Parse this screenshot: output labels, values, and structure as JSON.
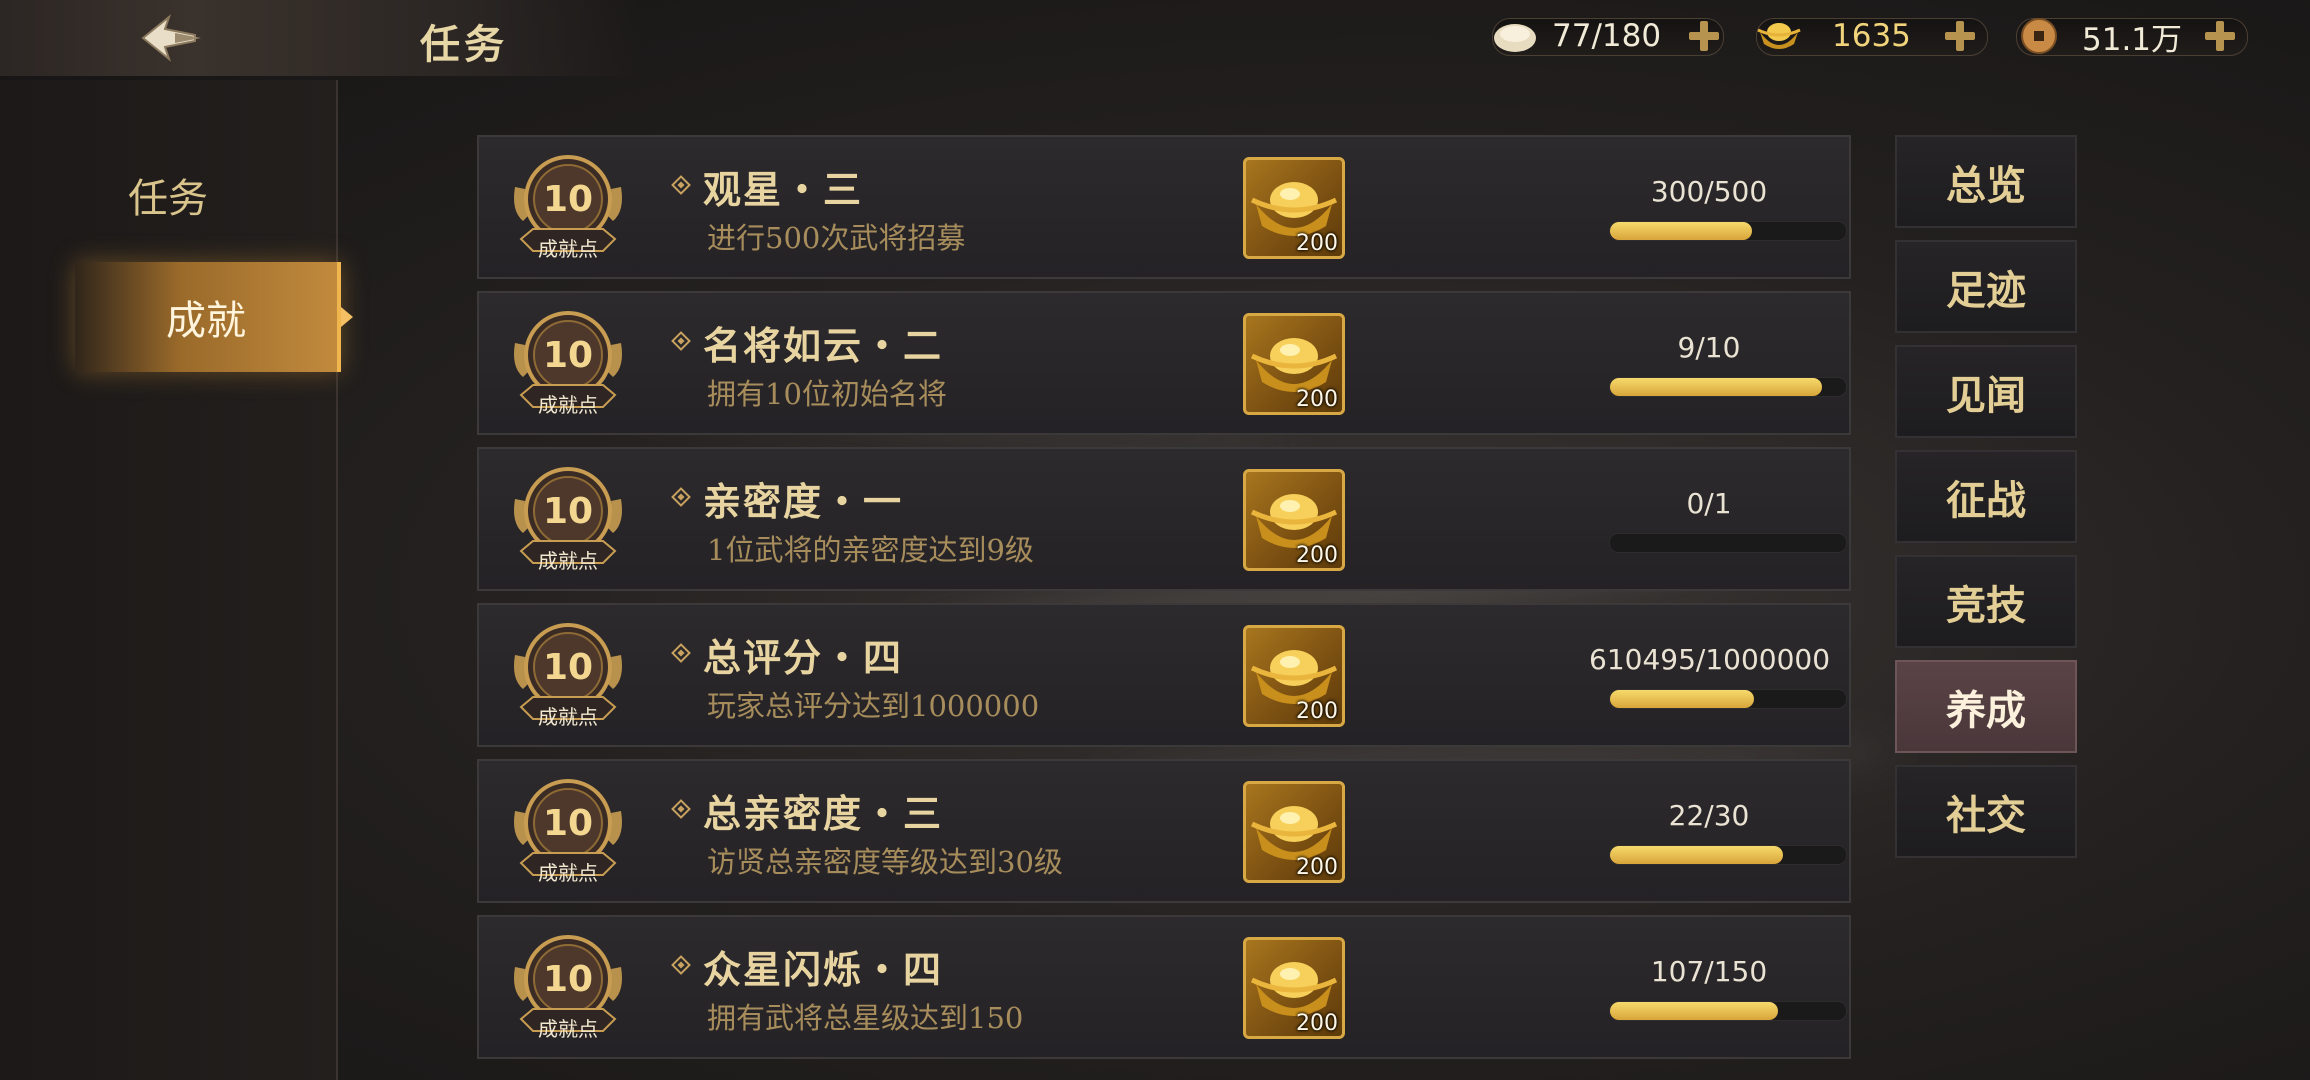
{
  "header": {
    "title": "任务",
    "resources": [
      {
        "icon": "bun-stamina-icon",
        "value": "77/180"
      },
      {
        "icon": "gold-ingot-icon",
        "value": "1635"
      },
      {
        "icon": "copper-coin-icon",
        "value": "51.1万"
      }
    ]
  },
  "sidebar": {
    "items": [
      {
        "label": "任务",
        "active": false
      },
      {
        "label": "成就",
        "active": true
      }
    ]
  },
  "tasks": [
    {
      "points": "10",
      "points_label": "成就点",
      "name": "观星・三",
      "desc": "进行500次武将招募",
      "reward_icon": "gold-ingot-icon",
      "reward_count": "200",
      "progress_text": "300/500",
      "progress": 0.6
    },
    {
      "points": "10",
      "points_label": "成就点",
      "name": "名将如云・二",
      "desc": "拥有10位初始名将",
      "reward_icon": "gold-ingot-icon",
      "reward_count": "200",
      "progress_text": "9/10",
      "progress": 0.9
    },
    {
      "points": "10",
      "points_label": "成就点",
      "name": "亲密度・一",
      "desc": "1位武将的亲密度达到9级",
      "reward_icon": "gold-ingot-icon",
      "reward_count": "200",
      "progress_text": "0/1",
      "progress": 0.0
    },
    {
      "points": "10",
      "points_label": "成就点",
      "name": "总评分・四",
      "desc": "玩家总评分达到1000000",
      "reward_icon": "gold-ingot-icon",
      "reward_count": "200",
      "progress_text": "610495/1000000",
      "progress": 0.61
    },
    {
      "points": "10",
      "points_label": "成就点",
      "name": "总亲密度・三",
      "desc": "访贤总亲密度等级达到30级",
      "reward_icon": "gold-ingot-icon",
      "reward_count": "200",
      "progress_text": "22/30",
      "progress": 0.733
    },
    {
      "points": "10",
      "points_label": "成就点",
      "name": "众星闪烁・四",
      "desc": "拥有武将总星级达到150",
      "reward_icon": "gold-ingot-icon",
      "reward_count": "200",
      "progress_text": "107/150",
      "progress": 0.713
    }
  ],
  "categories": [
    {
      "label": "总览",
      "active": false
    },
    {
      "label": "足迹",
      "active": false
    },
    {
      "label": "见闻",
      "active": false
    },
    {
      "label": "征战",
      "active": false
    },
    {
      "label": "竞技",
      "active": false
    },
    {
      "label": "养成",
      "active": true
    },
    {
      "label": "社交",
      "active": false
    }
  ],
  "colors": {
    "accent_gold": "#d8a43a",
    "bar_fill": "#f2cf5f",
    "active_tab": "#4a373a"
  }
}
